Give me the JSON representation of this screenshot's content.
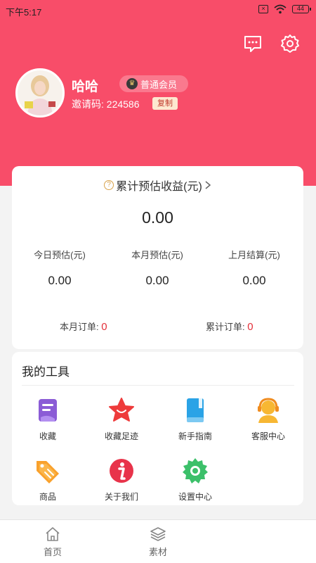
{
  "status": {
    "time": "下午5:17",
    "battery": "44"
  },
  "profile": {
    "name": "哈哈",
    "member_level": "普通会员",
    "invite_label": "邀请码:",
    "invite_code": "224586",
    "copy_label": "复制"
  },
  "earnings": {
    "title": "累计预估收益(元)",
    "total": "0.00",
    "stats": [
      {
        "label": "今日预估(元)",
        "value": "0.00"
      },
      {
        "label": "本月预估(元)",
        "value": "0.00"
      },
      {
        "label": "上月结算(元)",
        "value": "0.00"
      }
    ],
    "orders": [
      {
        "label": "本月订单:",
        "count": "0"
      },
      {
        "label": "累计订单:",
        "count": "0"
      }
    ]
  },
  "tools": {
    "title": "我的工具",
    "items": [
      {
        "label": "收藏",
        "icon": "favorites-icon"
      },
      {
        "label": "收藏足迹",
        "icon": "star-icon"
      },
      {
        "label": "新手指南",
        "icon": "book-icon"
      },
      {
        "label": "客服中心",
        "icon": "customer-service-icon"
      },
      {
        "label": "商品",
        "icon": "tag-icon"
      },
      {
        "label": "关于我们",
        "icon": "info-icon"
      },
      {
        "label": "设置中心",
        "icon": "gear-icon"
      }
    ]
  },
  "nav": {
    "items": [
      {
        "label": "首页",
        "icon": "home-icon"
      },
      {
        "label": "素材",
        "icon": "layers-icon"
      }
    ]
  },
  "colors": {
    "brand": "#f84d69",
    "accent_red": "#e3303a"
  }
}
